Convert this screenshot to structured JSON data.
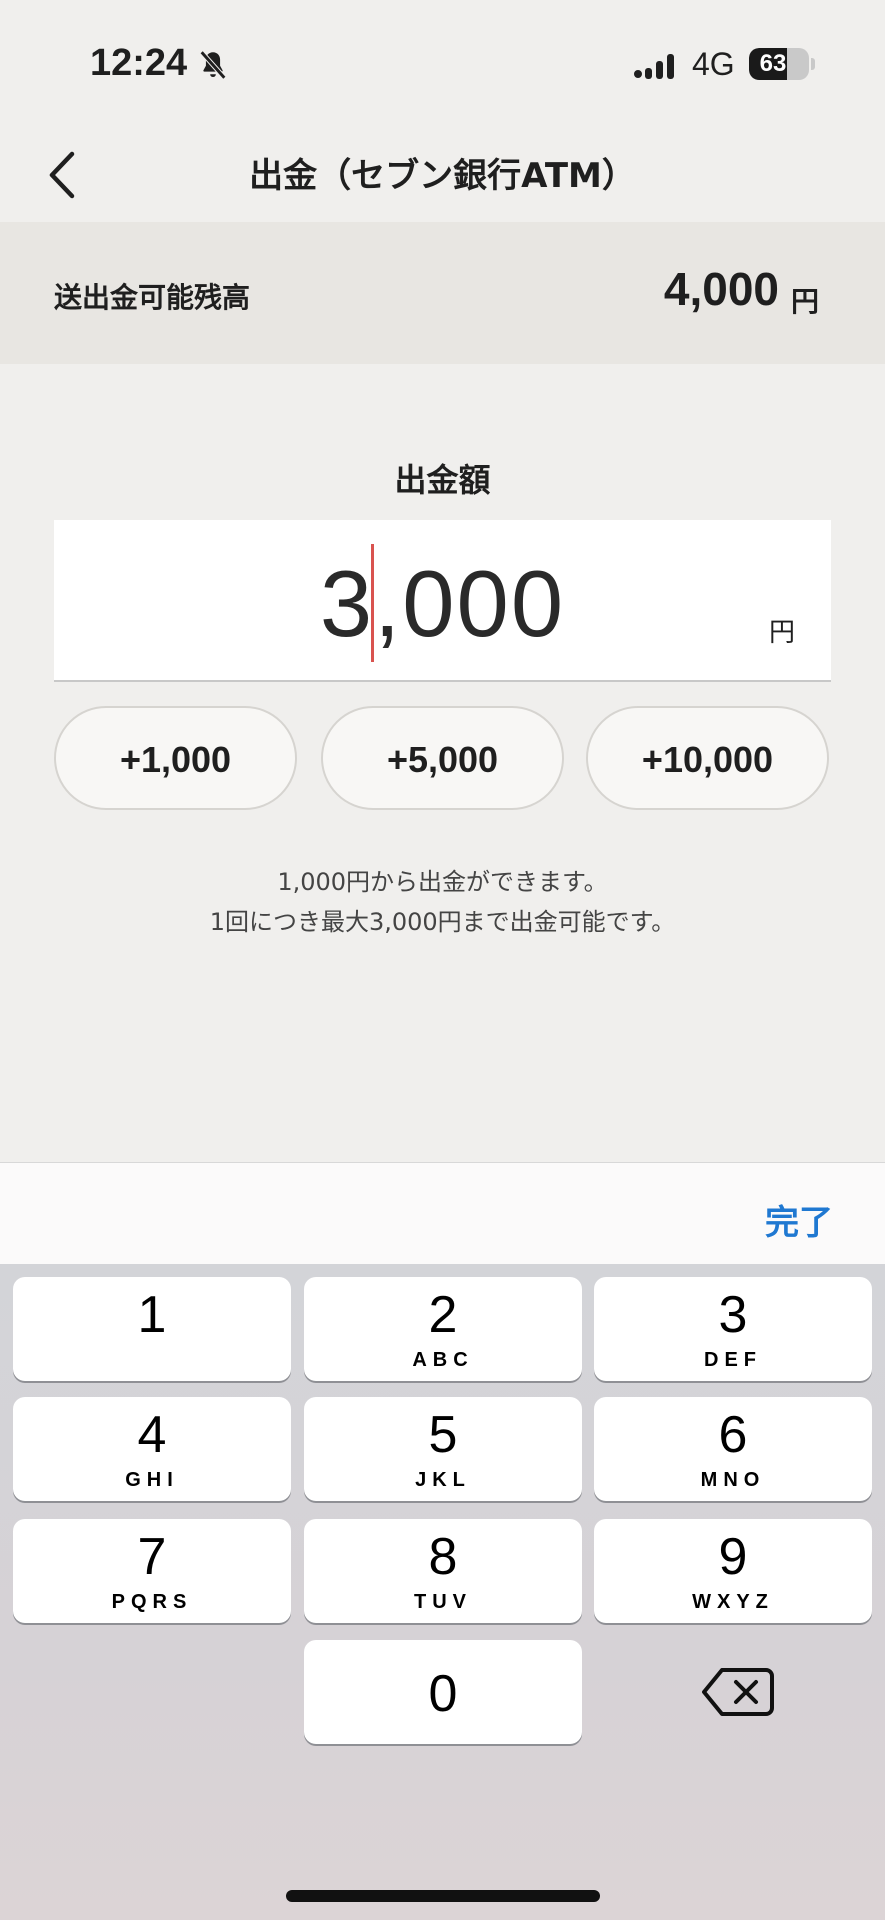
{
  "status_bar": {
    "time": "12:24",
    "network": "4G",
    "battery": "63",
    "battery_level": 0.63
  },
  "nav": {
    "title": "出金（セブン銀行ATM）"
  },
  "balance": {
    "label": "送出金可能残高",
    "value": "4,000",
    "unit": "円"
  },
  "amount": {
    "label": "出金額",
    "value": "3,000",
    "unit": "円"
  },
  "quick_buttons": [
    "+1,000",
    "+5,000",
    "+10,000"
  ],
  "notes": {
    "line1": "1,000円から出金ができます。",
    "line2": "1回につき最大3,000円まで出金可能です。"
  },
  "keyboard": {
    "done_label": "完了",
    "keys": [
      {
        "num": "1",
        "letters": ""
      },
      {
        "num": "2",
        "letters": "ABC"
      },
      {
        "num": "3",
        "letters": "DEF"
      },
      {
        "num": "4",
        "letters": "GHI"
      },
      {
        "num": "5",
        "letters": "JKL"
      },
      {
        "num": "6",
        "letters": "MNO"
      },
      {
        "num": "7",
        "letters": "PQRS"
      },
      {
        "num": "8",
        "letters": "TUV"
      },
      {
        "num": "9",
        "letters": "WXYZ"
      },
      {
        "num": "0",
        "letters": ""
      }
    ]
  },
  "colors": {
    "accent": "#1f78d1",
    "caret": "#d9534f"
  },
  "icons": {
    "back": "chevron-left-icon",
    "bell": "bell-slash-icon",
    "signal": "signal-icon",
    "delete": "backspace-icon"
  }
}
